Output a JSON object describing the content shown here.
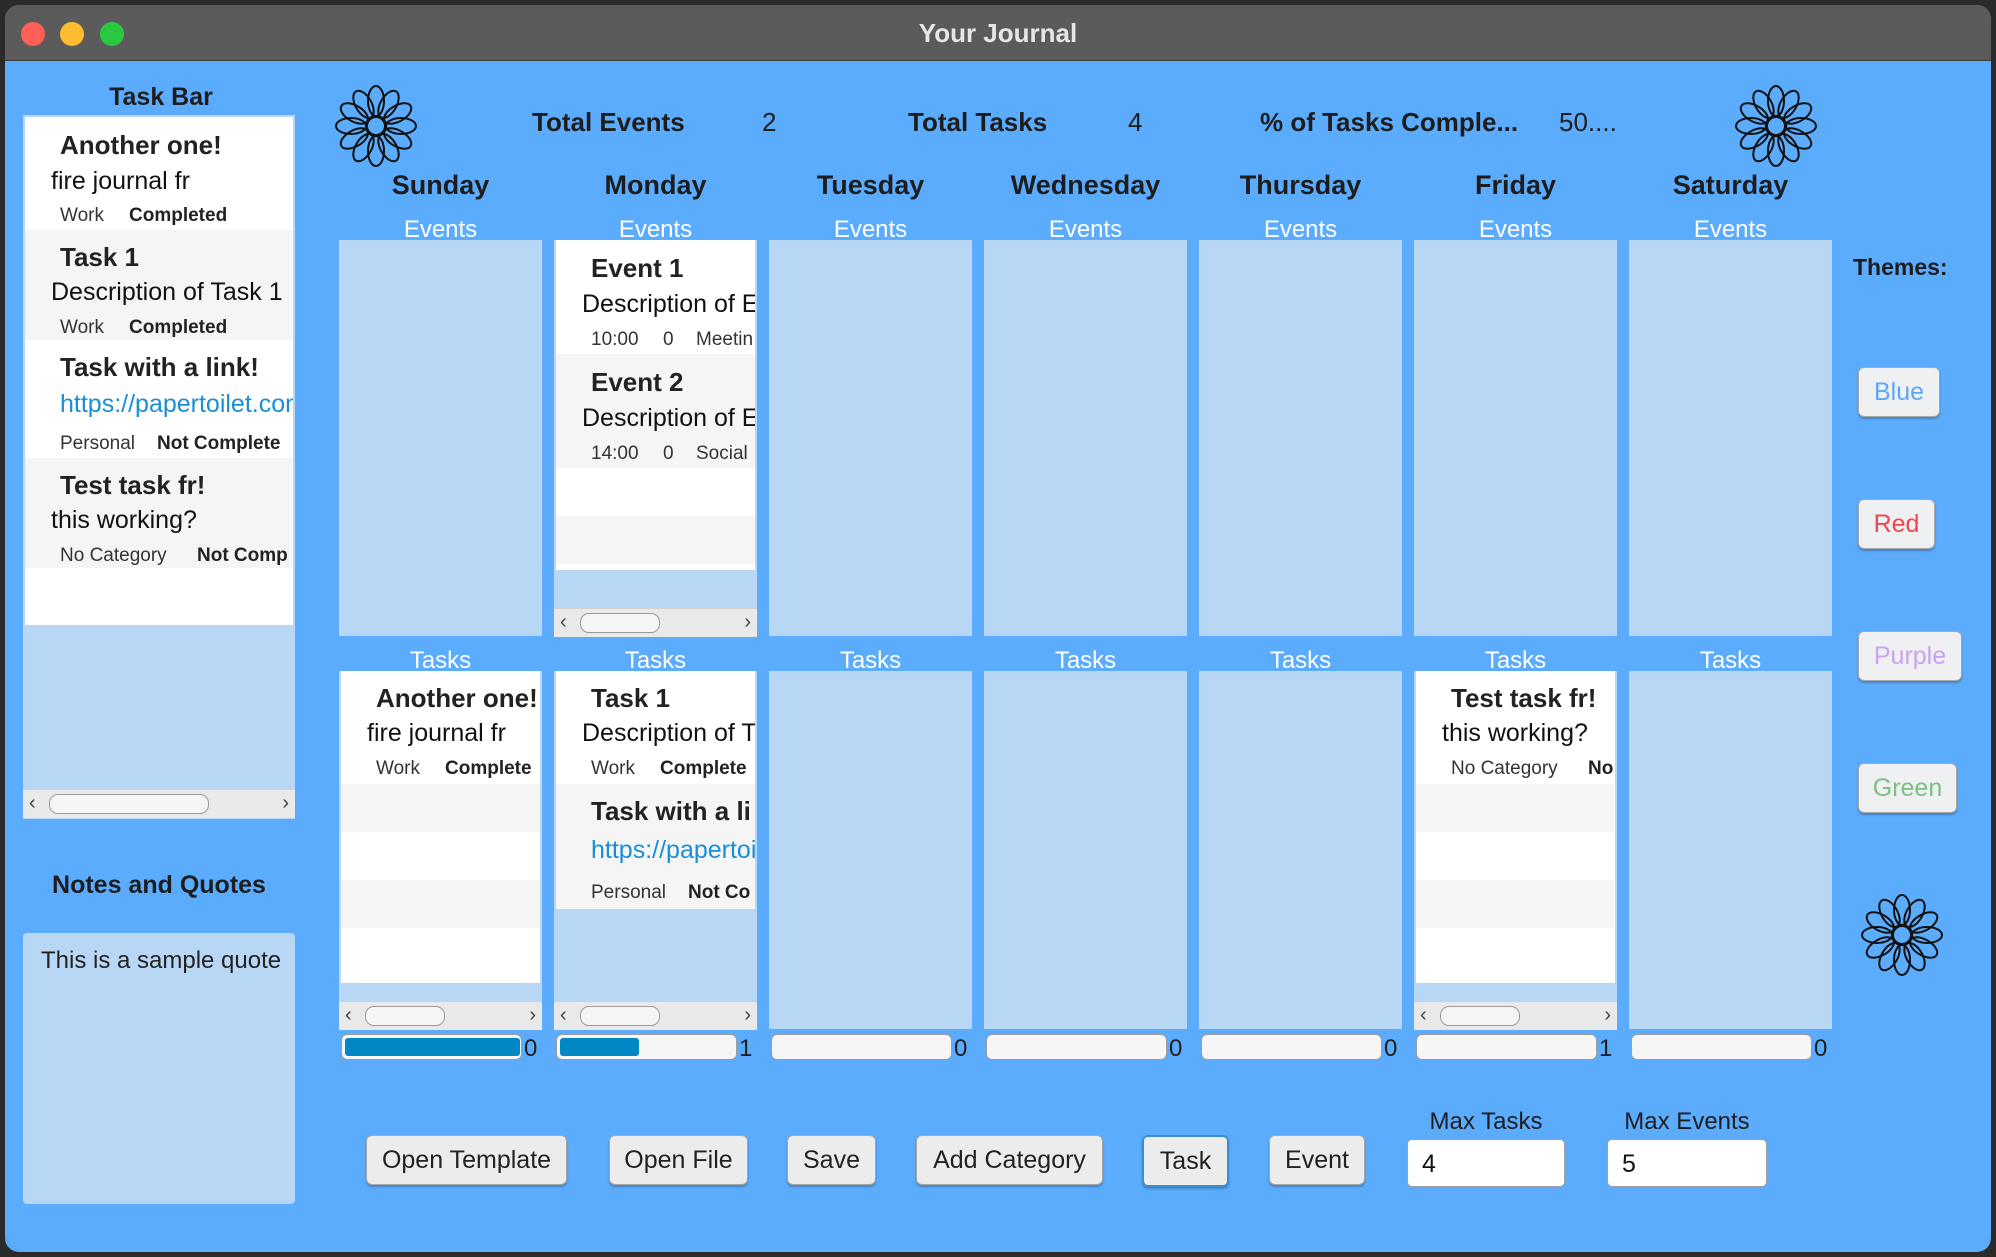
{
  "window": {
    "title": "Your Journal"
  },
  "sidebar": {
    "taskbar_title": "Task Bar",
    "tasks": [
      {
        "title": "Another one!",
        "description": "fire journal fr",
        "category": "Work",
        "status": "Completed"
      },
      {
        "title": "Task 1",
        "description": "Description of Task 1",
        "category": "Work",
        "status": "Completed"
      },
      {
        "title": "Task with a link!",
        "description": "https://papertoilet.com",
        "category": "Personal",
        "status": "Not Complete"
      },
      {
        "title": "Test task fr!",
        "description": "this working?",
        "category": "No Category",
        "status": "Not Comp"
      }
    ],
    "notes_title": "Notes and Quotes",
    "notes_text": "This is a sample quote"
  },
  "stats": {
    "total_events_label": "Total Events",
    "total_events_value": "2",
    "total_tasks_label": "Total Tasks",
    "total_tasks_value": "4",
    "pct_label": "% of Tasks Comple...",
    "pct_value": "50...."
  },
  "week": {
    "events_label": "Events",
    "tasks_label": "Tasks",
    "days": [
      {
        "name": "Sunday",
        "events": [],
        "tasks": [
          {
            "title": "Another one!",
            "description": "fire journal fr",
            "category": "Work",
            "status": "Complete"
          }
        ],
        "progress": 1.0,
        "count": "0"
      },
      {
        "name": "Monday",
        "events": [
          {
            "title": "Event 1",
            "description": "Description of Ev",
            "time": "10:00",
            "num": "0",
            "category": "Meetin"
          },
          {
            "title": "Event 2",
            "description": "Description of Ev",
            "time": "14:00",
            "num": "0",
            "category": "Social"
          }
        ],
        "tasks": [
          {
            "title": "Task 1",
            "description": "Description of Ta",
            "category": "Work",
            "status": "Complete"
          },
          {
            "title": "Task with a li",
            "description": "https://papertoi",
            "category": "Personal",
            "status": "Not Co"
          }
        ],
        "progress": 0.45,
        "count": "1"
      },
      {
        "name": "Tuesday",
        "events": [],
        "tasks": [],
        "progress": 0,
        "count": "0"
      },
      {
        "name": "Wednesday",
        "events": [],
        "tasks": [],
        "progress": 0,
        "count": "0"
      },
      {
        "name": "Thursday",
        "events": [],
        "tasks": [],
        "progress": 0,
        "count": "0"
      },
      {
        "name": "Friday",
        "events": [],
        "tasks": [
          {
            "title": "Test task fr!",
            "description": "this working?",
            "category": "No Category",
            "status": "No"
          }
        ],
        "progress": 0,
        "count": "1"
      },
      {
        "name": "Saturday",
        "events": [],
        "tasks": [],
        "progress": 0,
        "count": "0"
      }
    ]
  },
  "themes": {
    "label": "Themes:",
    "buttons": [
      {
        "label": "Blue",
        "color": "#5ca7f5"
      },
      {
        "label": "Red",
        "color": "#f0454f"
      },
      {
        "label": "Purple",
        "color": "#c8a4f0"
      },
      {
        "label": "Green",
        "color": "#7fbf86"
      }
    ]
  },
  "toolbar": {
    "open_template": "Open Template",
    "open_file": "Open File",
    "save": "Save",
    "add_category": "Add Category",
    "task": "Task",
    "event": "Event",
    "max_tasks_label": "Max Tasks",
    "max_tasks_value": "4",
    "max_events_label": "Max Events",
    "max_events_value": "5"
  },
  "colors": {
    "background": "#5cacfe",
    "panel": "#b8d7f5",
    "progress_fill": "#0087c4"
  }
}
